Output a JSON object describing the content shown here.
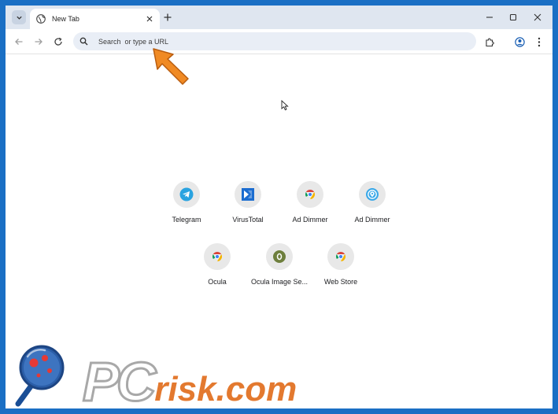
{
  "browser": {
    "tab": {
      "title": "New Tab"
    },
    "omnibox": {
      "text": "Search  or type a URL"
    }
  },
  "shortcuts": [
    {
      "label": "Telegram",
      "icon": "telegram-icon"
    },
    {
      "label": "VirusTotal",
      "icon": "virustotal-icon"
    },
    {
      "label": "Ad Dimmer",
      "icon": "chrome-icon"
    },
    {
      "label": "Ad Dimmer",
      "icon": "location-target-icon"
    },
    {
      "label": "Ocula",
      "icon": "chrome-icon"
    },
    {
      "label": "Ocula Image Se...",
      "icon": "letter-o-icon"
    },
    {
      "label": "Web Store",
      "icon": "chrome-icon"
    }
  ],
  "watermark": {
    "brand_outline": "PC",
    "brand_text": "risk.com"
  },
  "colors": {
    "desktop_bg": "#1a6fc4",
    "tabstrip_bg": "#dfe6f0",
    "omnibox_bg": "#e9eef6",
    "annotation_arrow": "#f08a24",
    "telegram": "#2aa3e0",
    "virustotal": "#1c6dd0",
    "ocula": "#6e7f3d"
  }
}
